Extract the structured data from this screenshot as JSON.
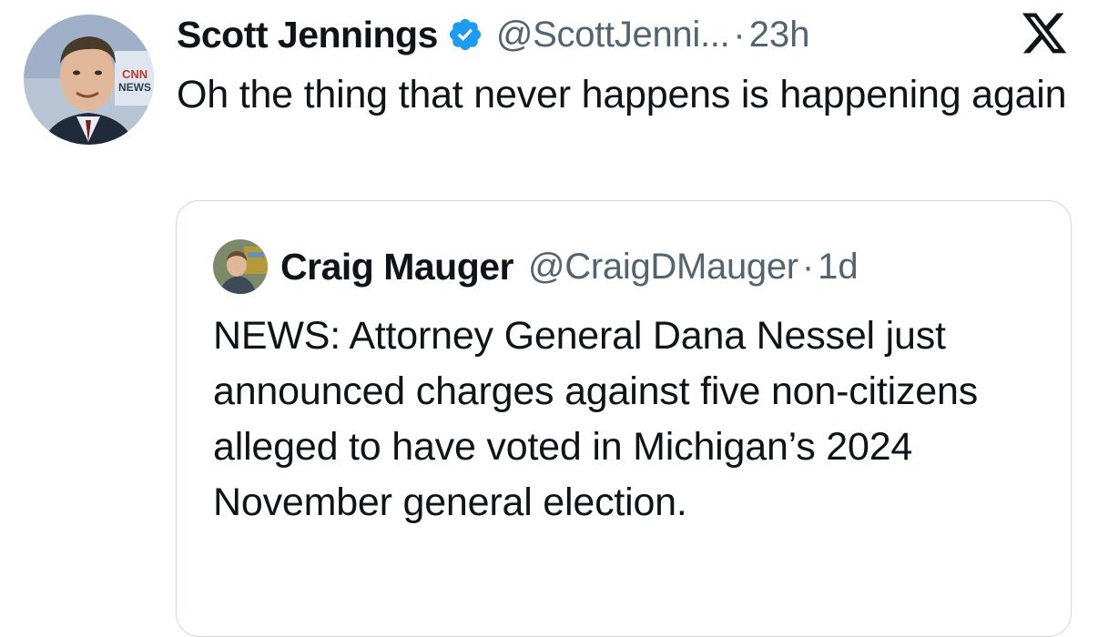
{
  "tweet": {
    "author_name": "Scott Jennings",
    "author_handle": "@ScottJenni...",
    "separator": "·",
    "time": "23h",
    "verified": true,
    "text": "Oh the thing that never happens is happening again",
    "avatar_icon": "user-avatar-photo"
  },
  "quoted_tweet": {
    "author_name": "Craig Mauger",
    "author_handle": "@CraigDMauger",
    "separator": "·",
    "time": "1d",
    "text": "NEWS: Attorney General Dana Nessel just announced charges against five non-citizens alleged to have voted in Michigan’s 2024 November general election.",
    "avatar_icon": "user-avatar-photo"
  },
  "icons": {
    "verified_badge": "verified-badge-icon",
    "platform_logo": "x-logo-icon"
  },
  "colors": {
    "text_primary": "#0f1419",
    "text_secondary": "#536471",
    "verified_blue": "#1d9bf0",
    "card_border": "#cfd9de"
  }
}
